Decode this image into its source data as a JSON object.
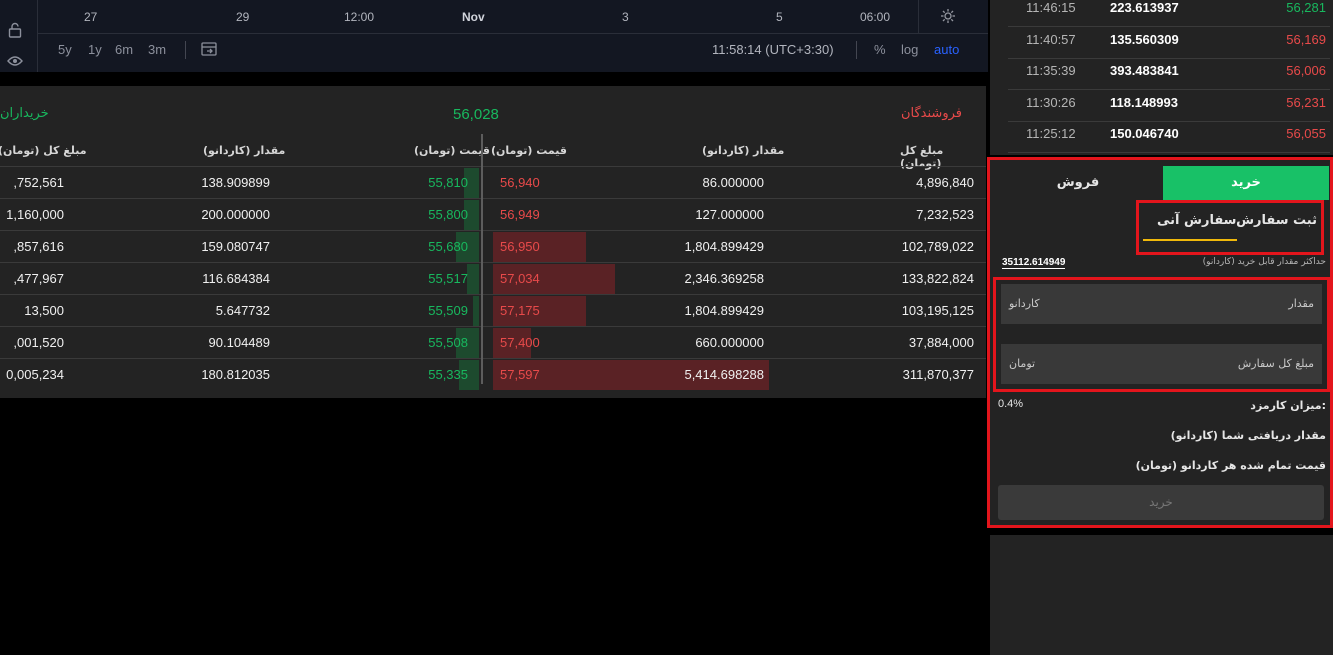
{
  "chart": {
    "x_ticks": [
      "27",
      "29",
      "12:00",
      "Nov",
      "3",
      "5",
      "06:00"
    ],
    "ranges": [
      "5y",
      "1y",
      "6m",
      "3m"
    ],
    "time": "11:58:14 (UTC+3:30)",
    "percent_label": "%",
    "log_label": "log",
    "auto_label": "auto",
    "sidebar_icons": [
      "lock-icon",
      "eye-icon"
    ]
  },
  "orderbook": {
    "buyers_title": "خریداران",
    "sellers_title": "فروشندگان",
    "last_price": "56,028",
    "headers": {
      "buy_total": "مبلغ کل (تومان)",
      "buy_amount": "مقدار (کاردانو)",
      "buy_price": "قیمت (تومان)",
      "sell_price": "قیمت (تومان)",
      "sell_amount": "مقدار (کاردانو)",
      "sell_total": "مبلغ کل (تومان)"
    },
    "rows": [
      {
        "buy_total": ",752,561",
        "buy_amount": "138.909899",
        "buy_price": "55,810",
        "sell_price": "56,940",
        "sell_amount": "86.000000",
        "sell_total": "4,896,840"
      },
      {
        "buy_total": "1,160,000",
        "buy_amount": "200.000000",
        "buy_price": "55,800",
        "sell_price": "56,949",
        "sell_amount": "127.000000",
        "sell_total": "7,232,523"
      },
      {
        "buy_total": ",857,616",
        "buy_amount": "159.080747",
        "buy_price": "55,680",
        "sell_price": "56,950",
        "sell_amount": "1,804.899429",
        "sell_total": "102,789,022"
      },
      {
        "buy_total": ",477,967",
        "buy_amount": "116.684384",
        "buy_price": "55,517",
        "sell_price": "57,034",
        "sell_amount": "2,346.369258",
        "sell_total": "133,822,824"
      },
      {
        "buy_total": "13,500",
        "buy_amount": "5.647732",
        "buy_price": "55,509",
        "sell_price": "57,175",
        "sell_amount": "1,804.899429",
        "sell_total": "103,195,125"
      },
      {
        "buy_total": ",001,520",
        "buy_amount": "90.104489",
        "buy_price": "55,508",
        "sell_price": "57,400",
        "sell_amount": "660.000000",
        "sell_total": "37,884,000"
      },
      {
        "buy_total": "0,005,234",
        "buy_amount": "180.812035",
        "buy_price": "55,335",
        "sell_price": "57,597",
        "sell_amount": "5,414.698288",
        "sell_total": "311,870,377"
      }
    ],
    "sell_depth_fraction": [
      0.0,
      0.0,
      0.32,
      0.42,
      0.32,
      0.13,
      0.95
    ],
    "buy_depth_fraction": [
      0.05,
      0.05,
      0.08,
      0.04,
      0.02,
      0.08,
      0.07
    ]
  },
  "trades": [
    {
      "time": "11:46:15",
      "amount": "223.613937",
      "price": "56,281",
      "side": "buy"
    },
    {
      "time": "11:40:57",
      "amount": "135.560309",
      "price": "56,169",
      "side": "sell"
    },
    {
      "time": "11:35:39",
      "amount": "393.483841",
      "price": "56,006",
      "side": "sell"
    },
    {
      "time": "11:30:26",
      "amount": "118.148993",
      "price": "56,231",
      "side": "sell"
    },
    {
      "time": "11:25:12",
      "amount": "150.046740",
      "price": "56,055",
      "side": "sell"
    }
  ],
  "order_form": {
    "buy_tab": "خرید",
    "sell_tab": "فروش",
    "limit_tab": "ثبت سفارش",
    "market_tab": "سفارش آنی",
    "max_label": "حداکثر مقدار قابل خرید (کاردانو)",
    "max_value": "35112.614949",
    "amount_label": "مقدار",
    "amount_unit": "کاردانو",
    "total_label": "مبلغ کل سفارش",
    "total_unit": "تومان",
    "fee_label": "میزان کارمزد:",
    "fee_value": "0.4%",
    "receive_label": "مقدار دریافتی شما (کاردانو)",
    "unit_price_label": "قیمت تمام شده هر کاردانو (تومان)",
    "submit_label": "خرید"
  },
  "colors": {
    "buy": "#18b85e",
    "sell": "#e84a4a",
    "highlight": "#e3151c",
    "active_tab": "#18c167",
    "tab_underline": "#f0b90b"
  }
}
